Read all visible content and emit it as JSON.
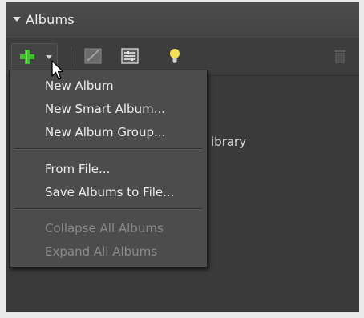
{
  "header": {
    "title": "Albums"
  },
  "toolbar": {
    "icons": [
      "add-icon",
      "edit-album-icon",
      "album-properties-icon",
      "lightbulb-icon",
      "trash-icon"
    ]
  },
  "list": {
    "partial_item": "ibrary"
  },
  "menu": {
    "items": [
      {
        "label": "New Album",
        "enabled": true
      },
      {
        "label": "New Smart Album...",
        "enabled": true
      },
      {
        "label": "New Album Group...",
        "enabled": true
      },
      {
        "label": "From File...",
        "enabled": true
      },
      {
        "label": "Save Albums to File...",
        "enabled": true
      },
      {
        "label": "Collapse All Albums",
        "enabled": false
      },
      {
        "label": "Expand All Albums",
        "enabled": false
      }
    ]
  },
  "colors": {
    "panel_bg": "#3a3a3a",
    "menu_bg": "#4c4c4c",
    "add_green": "#3fbf2a",
    "bulb_yellow": "#f3e15a",
    "disabled_text": "#8a8a8a"
  }
}
